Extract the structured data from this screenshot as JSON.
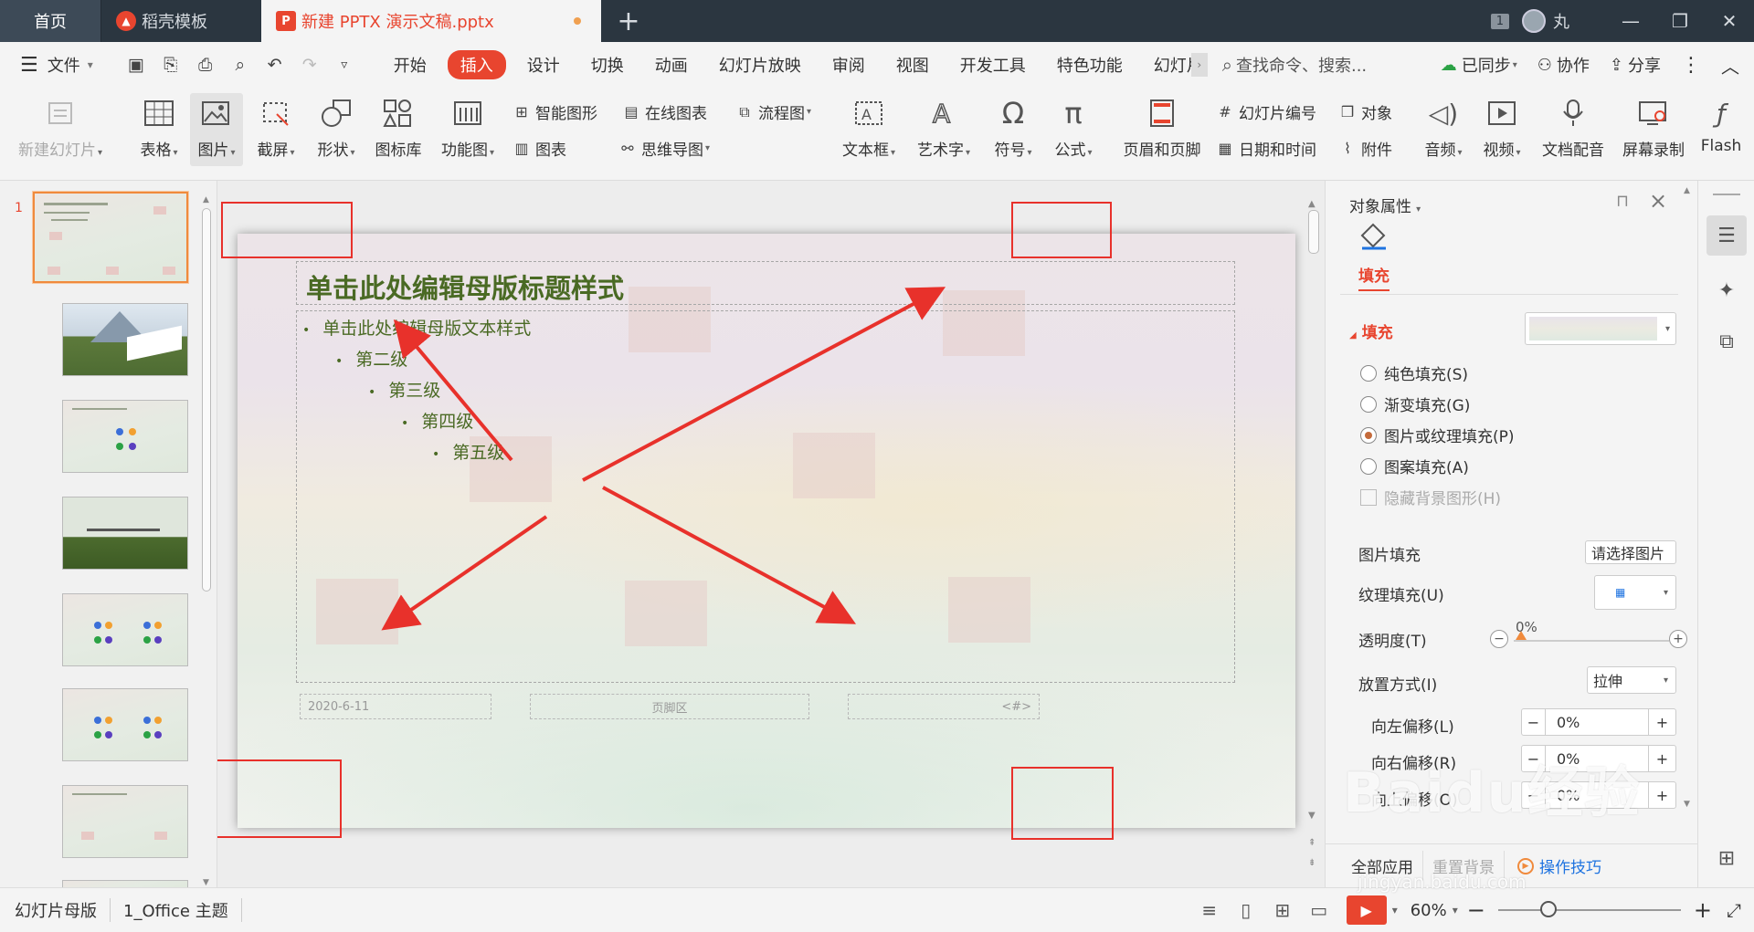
{
  "titlebar": {
    "tabs": [
      {
        "label": "首页"
      },
      {
        "label": "稻壳模板"
      },
      {
        "label": "新建 PPTX 演示文稿.pptx"
      }
    ],
    "add_tab": "+",
    "badge": "1",
    "user_name": "丸",
    "window_buttons": [
      "—",
      "❐",
      "✕"
    ]
  },
  "menubar": {
    "file_label": "文件",
    "tabs": [
      "开始",
      "插入",
      "设计",
      "切换",
      "动画",
      "幻灯片放映",
      "审阅",
      "视图",
      "开发工具",
      "特色功能",
      "幻灯片"
    ],
    "active_tab": "插入",
    "search_placeholder": "查找命令、搜索...",
    "right": [
      "已同步",
      "协作",
      "分享"
    ]
  },
  "ribbon": {
    "new_slide": "新建幻灯片",
    "table": "表格",
    "picture": "图片",
    "screenshot": "截屏",
    "shape": "形状",
    "icon_lib": "图标库",
    "func_chart": "功能图",
    "smart_art": "智能图形",
    "chart": "图表",
    "online_chart": "在线图表",
    "mind_map": "思维导图",
    "flowchart": "流程图",
    "textbox": "文本框",
    "wordart": "艺术字",
    "symbol": "符号",
    "formula": "公式",
    "header_footer": "页眉和页脚",
    "slide_number": "幻灯片编号",
    "datetime": "日期和时间",
    "object": "对象",
    "attachment": "附件",
    "audio": "音频",
    "video": "视频",
    "doc_voice": "文档配音",
    "screen_record": "屏幕录制",
    "flash": "Flash"
  },
  "slide_pane": {
    "selected_number": "1"
  },
  "slide": {
    "title": "单击此处编辑母版标题样式",
    "levels": [
      "单击此处编辑母版文本样式",
      "第二级",
      "第三级",
      "第四级",
      "第五级"
    ],
    "footer_date": "2020-6-11",
    "footer_center": "页脚区",
    "footer_number": "<#>"
  },
  "props": {
    "header": "对象属性",
    "tab": "填充",
    "section": "填充",
    "options": [
      "纯色填充(S)",
      "渐变填充(G)",
      "图片或纹理填充(P)",
      "图案填充(A)"
    ],
    "selected_option": "图片或纹理填充(P)",
    "hide_bg": "隐藏背景图形(H)",
    "picture_fill_label": "图片填充",
    "picture_fill_value": "请选择图片",
    "texture_fill_label": "纹理填充(U)",
    "transparency_label": "透明度(T)",
    "transparency_value": "0%",
    "placement_label": "放置方式(I)",
    "placement_value": "拉伸",
    "offset_left_label": "向左偏移(L)",
    "offset_left_value": "0%",
    "offset_right_label": "向右偏移(R)",
    "offset_right_value": "0%",
    "offset_up_label": "向上偏移(O)",
    "offset_up_value": "0%",
    "apply_all": "全部应用",
    "reset_bg": "重置背景",
    "tips": "操作技巧"
  },
  "statusbar": {
    "mode": "幻灯片母版",
    "theme": "1_Office 主题",
    "zoom": "60%"
  },
  "watermark": {
    "brand": "Baidu经验",
    "url": "jingyan.baidu.com"
  },
  "colors": {
    "accent": "#e8452f",
    "annotation_red": "#e8312b",
    "slide_text": "#4a6a24"
  }
}
